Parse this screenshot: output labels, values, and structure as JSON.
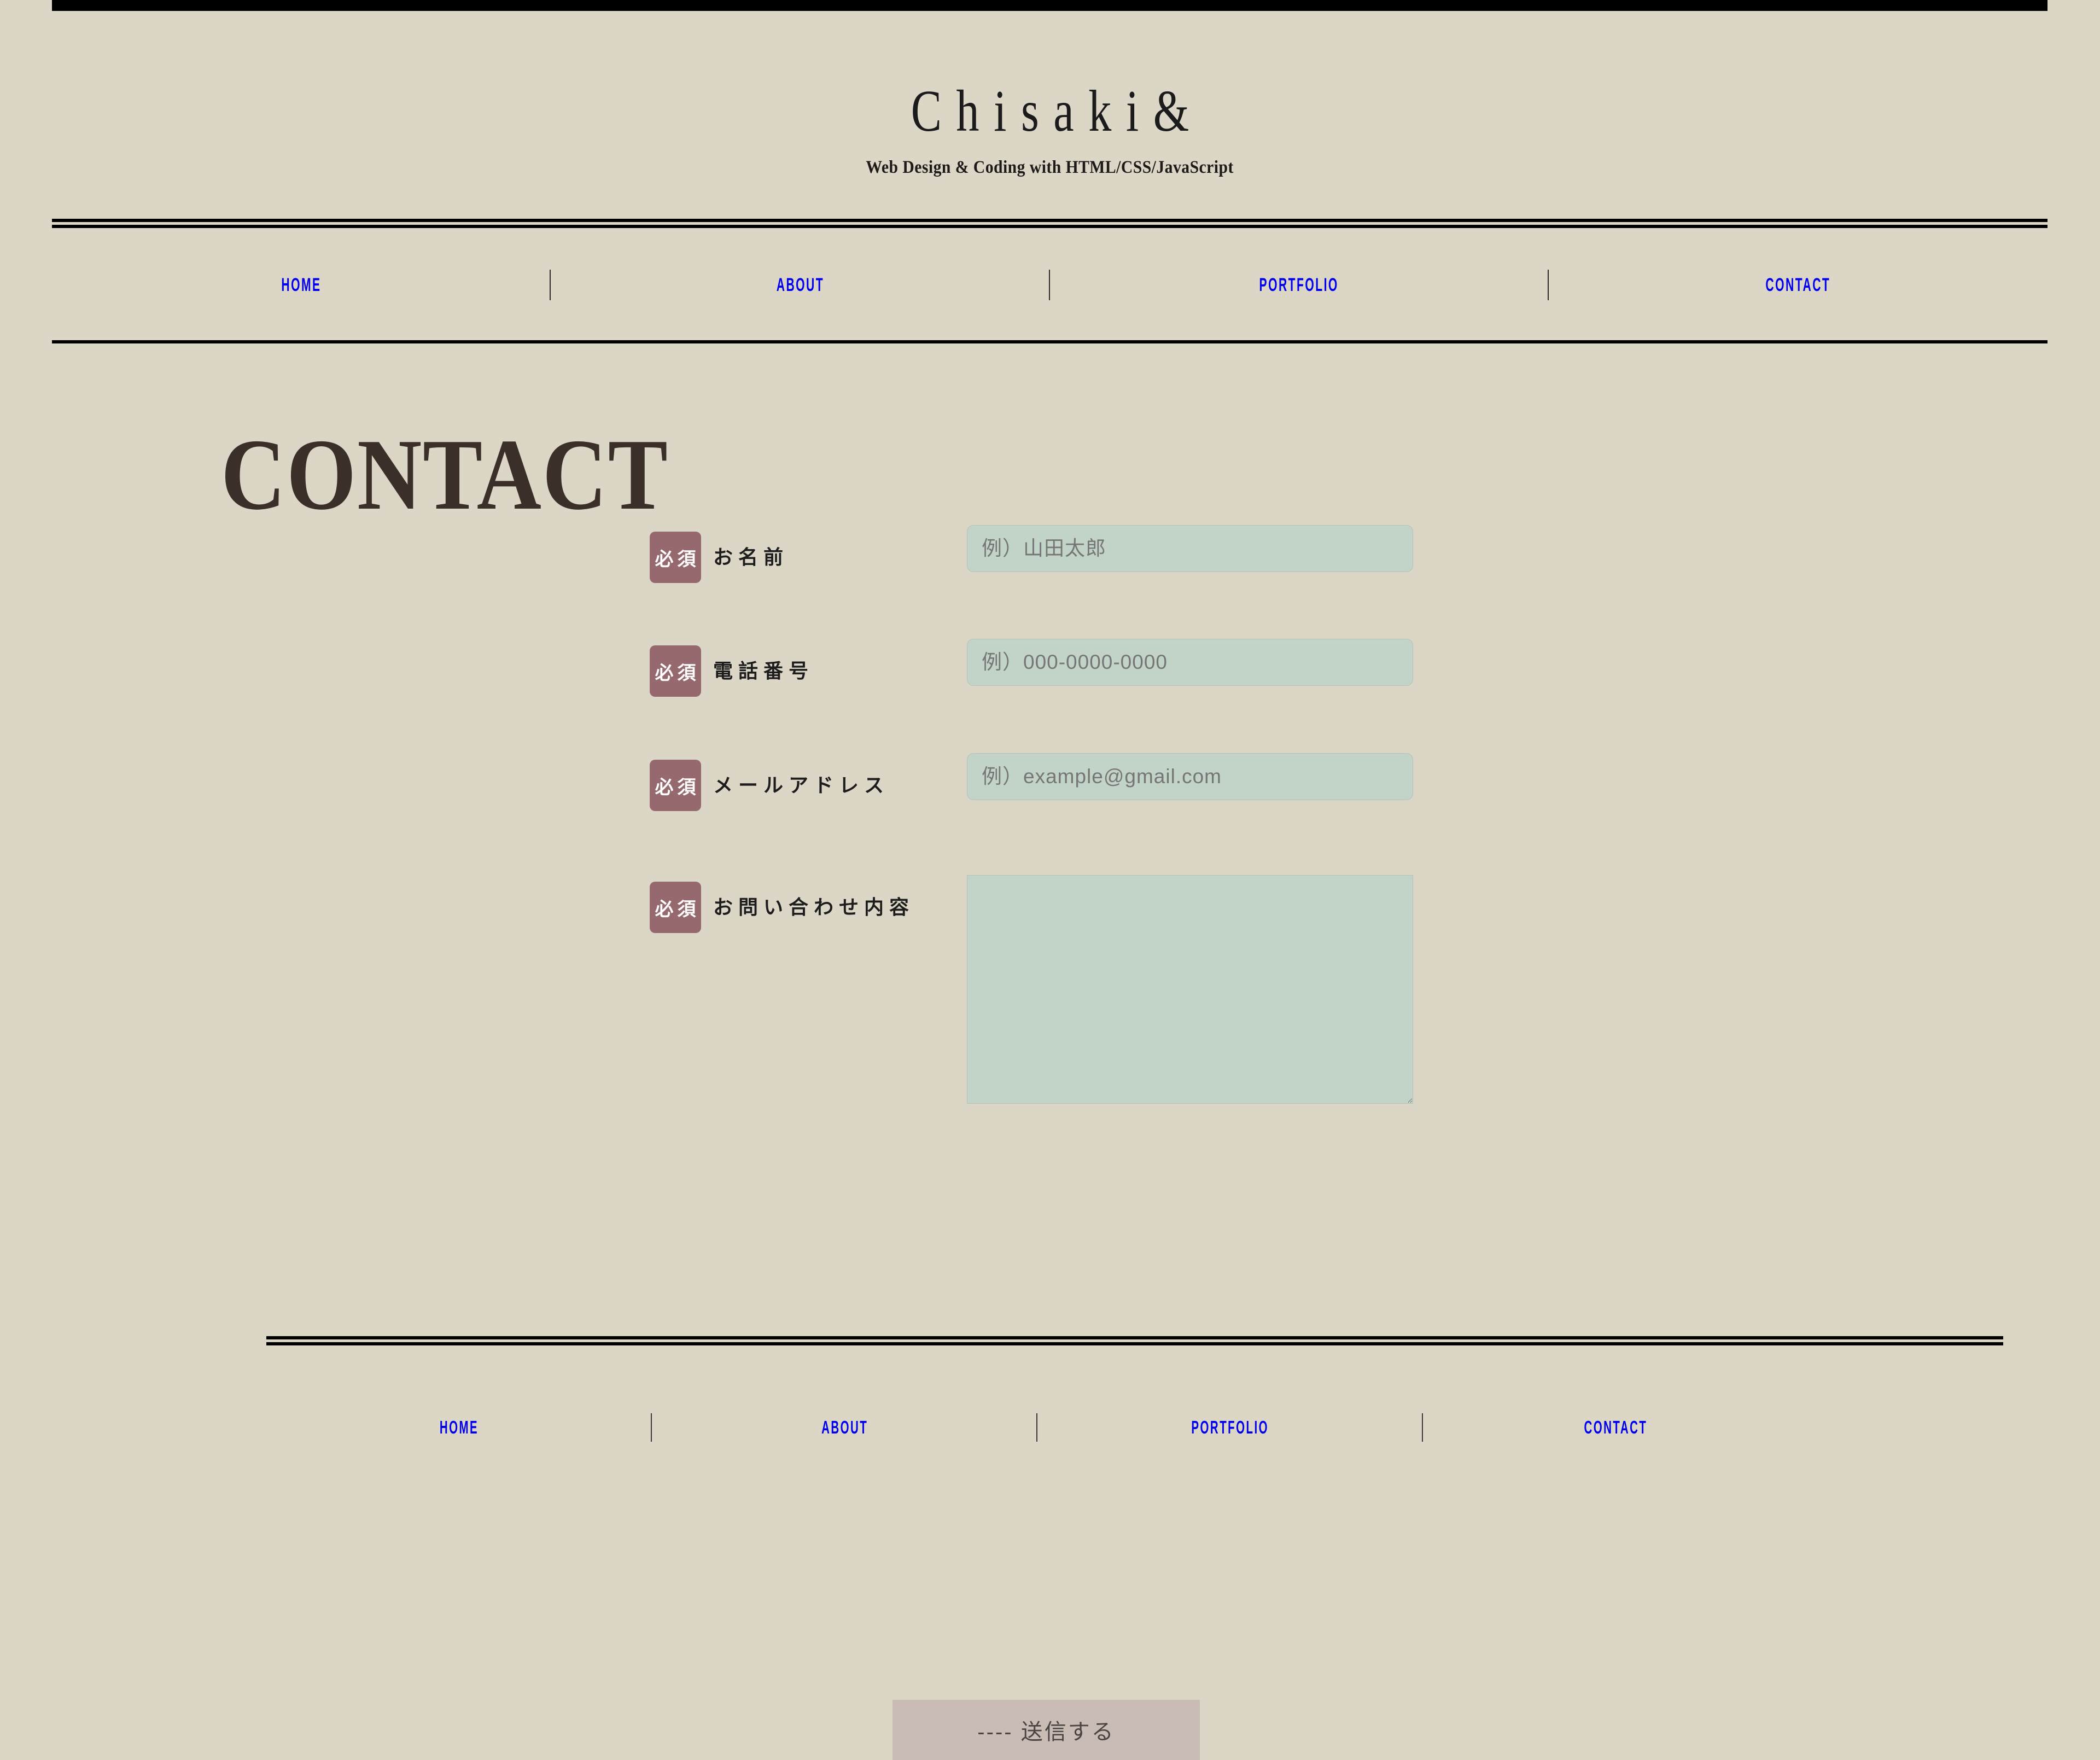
{
  "site": {
    "logo_text": "Chisaki&",
    "tagline": "Web Design & Coding with HTML/CSS/JavaScript"
  },
  "nav": {
    "items": [
      {
        "label": "HOME"
      },
      {
        "label": "ABOUT"
      },
      {
        "label": "PORTFOLIO"
      },
      {
        "label": "CONTACT"
      }
    ]
  },
  "page": {
    "title": "CONTACT"
  },
  "form": {
    "required_badge": "必須",
    "rows": [
      {
        "label": "お名前",
        "placeholder": "例）山田太郎",
        "value": "",
        "type": "text"
      },
      {
        "label": "電話番号",
        "placeholder": "例）000-0000-0000",
        "value": "",
        "type": "tel"
      },
      {
        "label": "メールアドレス",
        "placeholder": "例）example@gmail.com",
        "value": "",
        "type": "email"
      },
      {
        "label": "お問い合わせ内容",
        "placeholder": "",
        "value": "",
        "type": "textarea"
      }
    ],
    "submit_label": "---- 送信する"
  },
  "footer": {
    "items": [
      {
        "label": "HOME"
      },
      {
        "label": "ABOUT"
      },
      {
        "label": "PORTFOLIO"
      },
      {
        "label": "CONTACT"
      }
    ]
  },
  "colors": {
    "background": "#dcd6c7",
    "rule": "#000000",
    "nav_link": "#0000ee",
    "heading": "#3a3029",
    "badge": "#96696e",
    "field": "#c2d3c8",
    "submit": "#c9bcb5"
  }
}
